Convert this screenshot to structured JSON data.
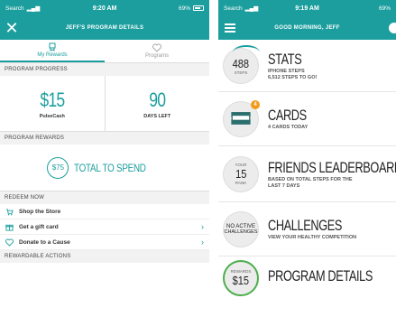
{
  "left": {
    "status": {
      "carrier": "Search",
      "time": "9:20 AM",
      "battery": "69%"
    },
    "header": {
      "title": "JEFF'S PROGRAM DETAILS"
    },
    "tabs": [
      {
        "label": "My Rewards"
      },
      {
        "label": "Programs"
      }
    ],
    "progress_label": "PROGRAM PROGRESS",
    "pulsecash": {
      "value": "$15",
      "label": "PulseCash"
    },
    "days_left": {
      "value": "90",
      "label": "DAYS LEFT"
    },
    "rewards_label": "PROGRAM REWARDS",
    "rewards": {
      "amount": "$75",
      "text": "TOTAL TO SPEND"
    },
    "redeem_label": "REDEEM NOW",
    "redeem_items": [
      {
        "label": "Shop the Store",
        "chevron": ""
      },
      {
        "label": "Get a gift card",
        "chevron": "›"
      },
      {
        "label": "Donate to a Cause",
        "chevron": "›"
      }
    ],
    "actions_label": "REWARDABLE ACTIONS"
  },
  "right": {
    "status": {
      "carrier": "Search",
      "time": "9:19 AM",
      "battery": "69%"
    },
    "header": {
      "title": "GOOD MORNING, JEFF"
    },
    "rows": [
      {
        "badge_top": "",
        "badge_num": "488",
        "badge_sub": "STEPS",
        "title": "STATS",
        "sub": "IPHONE STEPS\n6,512 STEPS TO GO!"
      },
      {
        "badge_num": "",
        "badge_sub": "",
        "title": "CARDS",
        "sub": "4 CARDS TODAY",
        "notif": "4"
      },
      {
        "badge_top": "YOUR",
        "badge_num": "15",
        "badge_sub": "RANK",
        "title": "FRIENDS LEADERBOARD",
        "sub": "BASED ON TOTAL STEPS FOR THE\nLAST 7 DAYS"
      },
      {
        "badge_top": "NO ACTIVE",
        "badge_num": "",
        "badge_sub": "CHALLENGES",
        "title": "CHALLENGES",
        "sub": "VIEW YOUR HEALTHY COMPETITION"
      },
      {
        "badge_top": "REWARDS",
        "badge_num": "$15",
        "badge_sub": "",
        "title": "PROGRAM DETAILS",
        "sub": ""
      }
    ]
  },
  "colors": {
    "accent": "#1c9e9e",
    "orange": "#f39a1a"
  }
}
